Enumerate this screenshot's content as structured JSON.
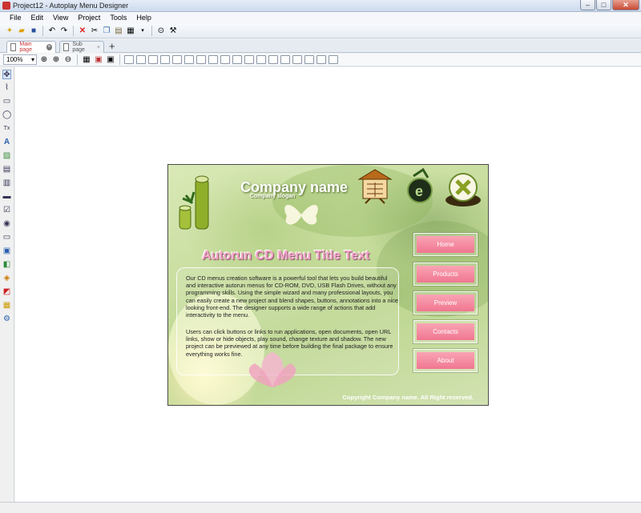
{
  "window": {
    "title": "Project12 - Autoplay Menu Designer",
    "btn_min": "–",
    "btn_max": "□",
    "btn_close": "✕"
  },
  "menubar": {
    "items": [
      "File",
      "Edit",
      "View",
      "Project",
      "Tools",
      "Help"
    ]
  },
  "tabs": [
    {
      "label": "Main page"
    },
    {
      "label": "Sub page"
    }
  ],
  "toolbar2": {
    "zoom": "100%"
  },
  "design": {
    "company_name": "Company name",
    "company_slogan": "Company slogan",
    "menu_title": "Autorun CD Menu Title Text",
    "para1": "Our CD menus creation software  is a powerful tool that lets you build beautiful and interactive autorun menus for CD-ROM, DVD, USB Flash Drives, without any programming skills. Using the simple wizard and many professional layouts, you can easily create a new project and blend shapes, buttons, annotations into a nice looking front-end. The designer supports a wide range of actions that add interactivity to the menu.",
    "para2": "Users can click buttons or links to run applications, open documents, open URL links, show or hide objects, play sound, change texture and shadow. The new project can be previewed at any time before building the final package to ensure everything works fine.",
    "buttons": [
      "Home",
      "Products",
      "Preview",
      "Contacts",
      "About"
    ],
    "copyright": "Copyright Company name. All Right reserved."
  }
}
